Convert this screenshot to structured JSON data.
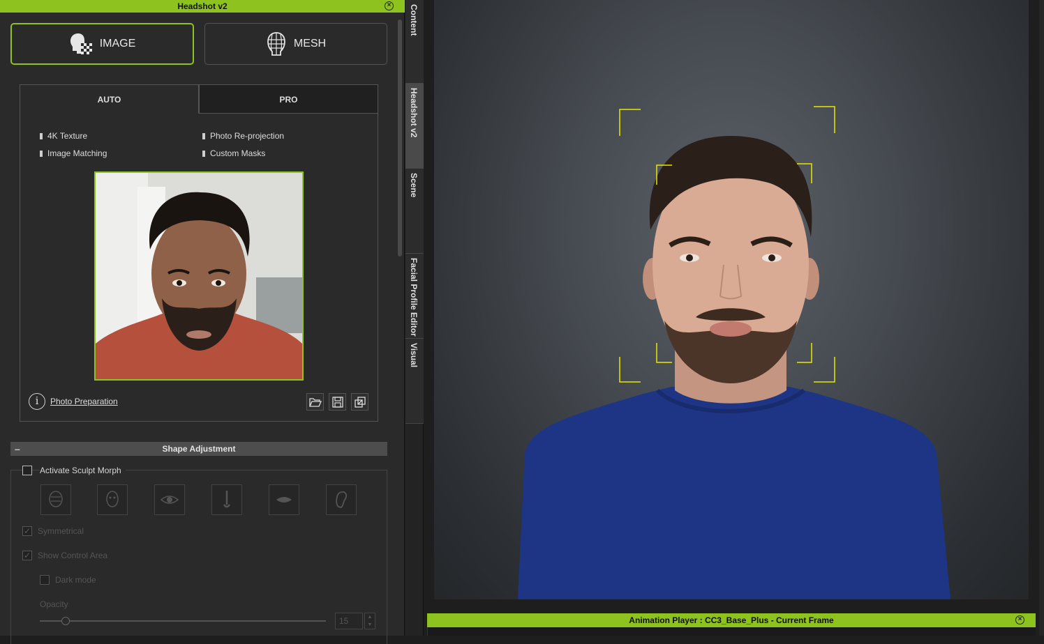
{
  "panel": {
    "title": "Headshot v2",
    "modes": {
      "image_label": "IMAGE",
      "mesh_label": "MESH"
    },
    "tabs": {
      "auto": "AUTO",
      "pro": "PRO"
    },
    "features": [
      "4K Texture",
      "Photo Re-projection",
      "Image Matching",
      "Custom Masks"
    ],
    "photo_preparation": "Photo Preparation",
    "shape_adjustment": {
      "title": "Shape Adjustment",
      "activate_sculpt_morph": "Activate Sculpt Morph",
      "symmetrical": "Symmetrical",
      "show_control_area": "Show Control Area",
      "dark_mode": "Dark mode",
      "opacity_label": "Opacity",
      "opacity_value": "15",
      "opacity_fraction": 0.09
    }
  },
  "side_tabs": [
    "Content",
    "Headshot v2",
    "Scene",
    "Facial Profile Editor",
    "Visual"
  ],
  "animation_player": {
    "title": "Animation Player : CC3_Base_Plus - Current Frame"
  },
  "colors": {
    "accent": "#8dc21f",
    "frame_marker": "#e8e800"
  }
}
